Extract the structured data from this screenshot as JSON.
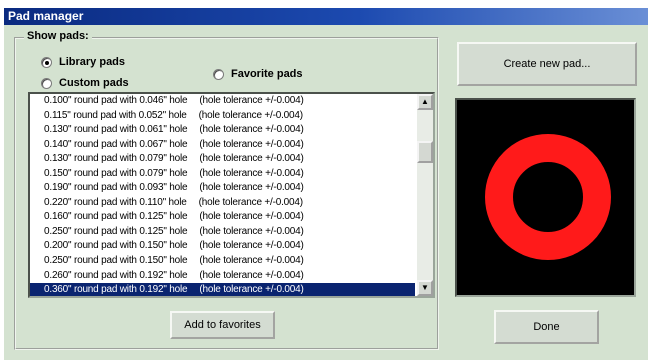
{
  "window": {
    "title": "Pad manager"
  },
  "show_pads": {
    "legend": "Show pads:",
    "options": [
      {
        "label": "Library pads",
        "checked": true
      },
      {
        "label": "Custom pads",
        "checked": false
      },
      {
        "label": "Favorite pads",
        "checked": false
      }
    ]
  },
  "pad_list": {
    "items": [
      {
        "text": "0.100\" round pad with 0.046\" hole",
        "tolerance": "(hole tolerance +/-0.004)"
      },
      {
        "text": "0.115\" round pad with 0.052\" hole",
        "tolerance": "(hole tolerance +/-0.004)"
      },
      {
        "text": "0.130\" round pad with 0.061\" hole",
        "tolerance": "(hole tolerance +/-0.004)"
      },
      {
        "text": "0.140\" round pad with 0.067\" hole",
        "tolerance": "(hole tolerance +/-0.004)"
      },
      {
        "text": "0.130\" round pad with 0.079\" hole",
        "tolerance": "(hole tolerance +/-0.004)"
      },
      {
        "text": "0.150\" round pad with 0.079\" hole",
        "tolerance": "(hole tolerance +/-0.004)"
      },
      {
        "text": "0.190\" round pad with 0.093\" hole",
        "tolerance": "(hole tolerance +/-0.004)"
      },
      {
        "text": "0.220\" round pad with 0.110\" hole",
        "tolerance": "(hole tolerance +/-0.004)"
      },
      {
        "text": "0.160\" round pad with 0.125\" hole",
        "tolerance": "(hole tolerance +/-0.004)"
      },
      {
        "text": "0.250\" round pad with 0.125\" hole",
        "tolerance": "(hole tolerance +/-0.004)"
      },
      {
        "text": "0.200\" round pad with 0.150\" hole",
        "tolerance": "(hole tolerance +/-0.004)"
      },
      {
        "text": "0.250\" round pad with 0.150\" hole",
        "tolerance": "(hole tolerance +/-0.004)"
      },
      {
        "text": "0.260\" round pad with 0.192\" hole",
        "tolerance": "(hole tolerance +/-0.004)"
      },
      {
        "text": "0.360\" round pad with 0.192\" hole",
        "tolerance": "(hole tolerance +/-0.004)",
        "selected": true
      }
    ],
    "scroll_up_icon": "arrow-up-icon",
    "scroll_down_icon": "arrow-down-icon"
  },
  "buttons": {
    "create_new_pad": "Create new pad...",
    "add_to_favorites": "Add to favorites",
    "done": "Done"
  },
  "preview": {
    "background": "#000000",
    "pad_color": "#ff1a1a",
    "pad_outer_diameter": 0.36,
    "hole_diameter": 0.192
  }
}
